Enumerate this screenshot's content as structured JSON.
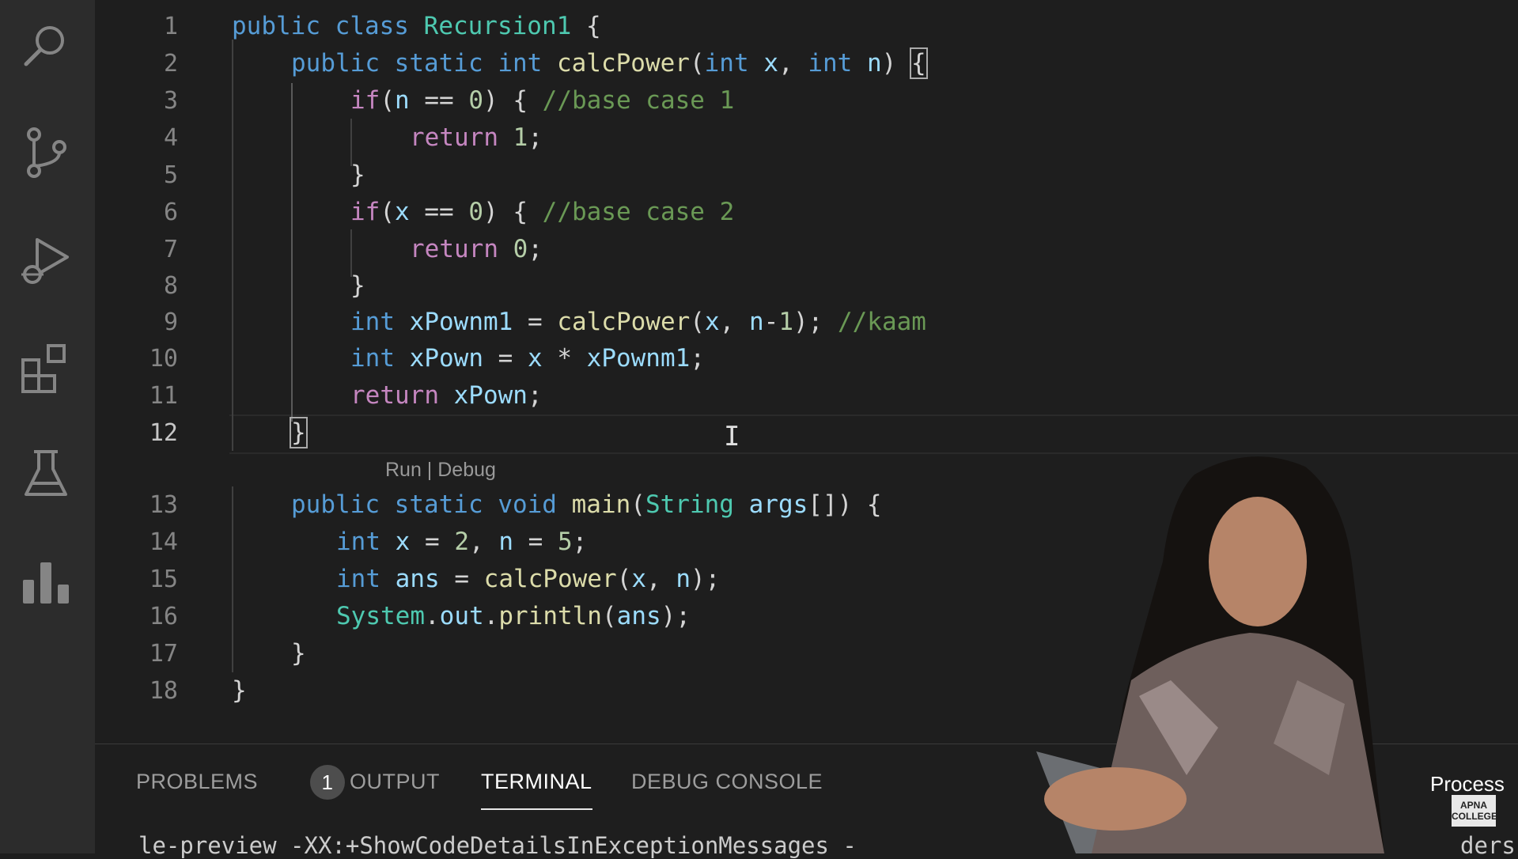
{
  "activity_bar": {
    "icons": [
      "search-icon",
      "source-control-icon",
      "run-debug-icon",
      "extensions-icon",
      "testing-icon",
      "chart-icon"
    ]
  },
  "editor": {
    "line_numbers": [
      "1",
      "2",
      "3",
      "4",
      "5",
      "6",
      "7",
      "8",
      "9",
      "10",
      "11",
      "12",
      "13",
      "14",
      "15",
      "16",
      "17",
      "18"
    ],
    "active_line": "12",
    "codelens": "Run | Debug",
    "code": {
      "l1_kw1": "public",
      "l1_kw2": "class",
      "l1_name": "Recursion1",
      "l1_rest": " {",
      "l2_kw1": "public",
      "l2_kw2": "static",
      "l2_kw3": "int",
      "l2_fn": "calcPower",
      "l2_p1": "(",
      "l2_kw4": "int",
      "l2_x": "x",
      "l2_c": ", ",
      "l2_kw5": "int",
      "l2_n": "n",
      "l2_p2": ") ",
      "l2_brace": "{",
      "l3_if": "if",
      "l3_a": "(",
      "l3_n": "n",
      "l3_b": " == ",
      "l3_num": "0",
      "l3_c": ") { ",
      "l3_cmt": "//base case 1",
      "l4_ret": "return",
      "l4_num": " 1",
      "l4_semi": ";",
      "l5": "}",
      "l6_if": "if",
      "l6_a": "(",
      "l6_x": "x",
      "l6_b": " == ",
      "l6_num": "0",
      "l6_c": ") { ",
      "l6_cmt": "//base case 2",
      "l7_ret": "return",
      "l7_num": " 0",
      "l7_semi": ";",
      "l8": "}",
      "l9_kw": "int",
      "l9_var": " xPownm1",
      "l9_eq": " = ",
      "l9_fn": "calcPower",
      "l9_a": "(",
      "l9_x": "x",
      "l9_c": ", ",
      "l9_n": "n",
      "l9_minus": "-",
      "l9_num": "1",
      "l9_d": "); ",
      "l9_cmt": "//kaam",
      "l10_kw": "int",
      "l10_var": " xPown",
      "l10_eq": " = ",
      "l10_x": "x",
      "l10_op": " * ",
      "l10_v2": "xPownm1",
      "l10_semi": ";",
      "l11_ret": "return",
      "l11_var": " xPown",
      "l11_semi": ";",
      "l12": "}",
      "l13_kw1": "public",
      "l13_kw2": "static",
      "l13_kw3": "void",
      "l13_fn": "main",
      "l13_a": "(",
      "l13_cls": "String",
      "l13_var": " args",
      "l13_b": "[]) {",
      "l14_kw": "int",
      "l14_x": " x",
      "l14_eq": " = ",
      "l14_n2": "2",
      "l14_c": ", ",
      "l14_n": "n",
      "l14_eq2": " = ",
      "l14_n5": "5",
      "l14_semi": ";",
      "l15_kw": "int",
      "l15_var": " ans",
      "l15_eq": " = ",
      "l15_fn": "calcPower",
      "l15_a": "(",
      "l15_x": "x",
      "l15_c": ", ",
      "l15_n": "n",
      "l15_d": ");",
      "l16_cls": "System",
      "l16_dot": ".",
      "l16_out": "out",
      "l16_dot2": ".",
      "l16_fn": "println",
      "l16_a": "(",
      "l16_var": "ans",
      "l16_d": ");",
      "l17": "}",
      "l18": "}"
    }
  },
  "panel": {
    "tabs": {
      "problems": "PROBLEMS",
      "problems_count": "1",
      "output": "OUTPUT",
      "terminal": "TERMINAL",
      "debug_console": "DEBUG CONSOLE"
    },
    "terminal_text": "le-preview -XX:+ShowCodeDetailsInExceptionMessages -",
    "terminal_right": "ders",
    "process_label": "Process"
  },
  "watermark": {
    "line1": "APNA",
    "line2": "COLLEGE"
  }
}
